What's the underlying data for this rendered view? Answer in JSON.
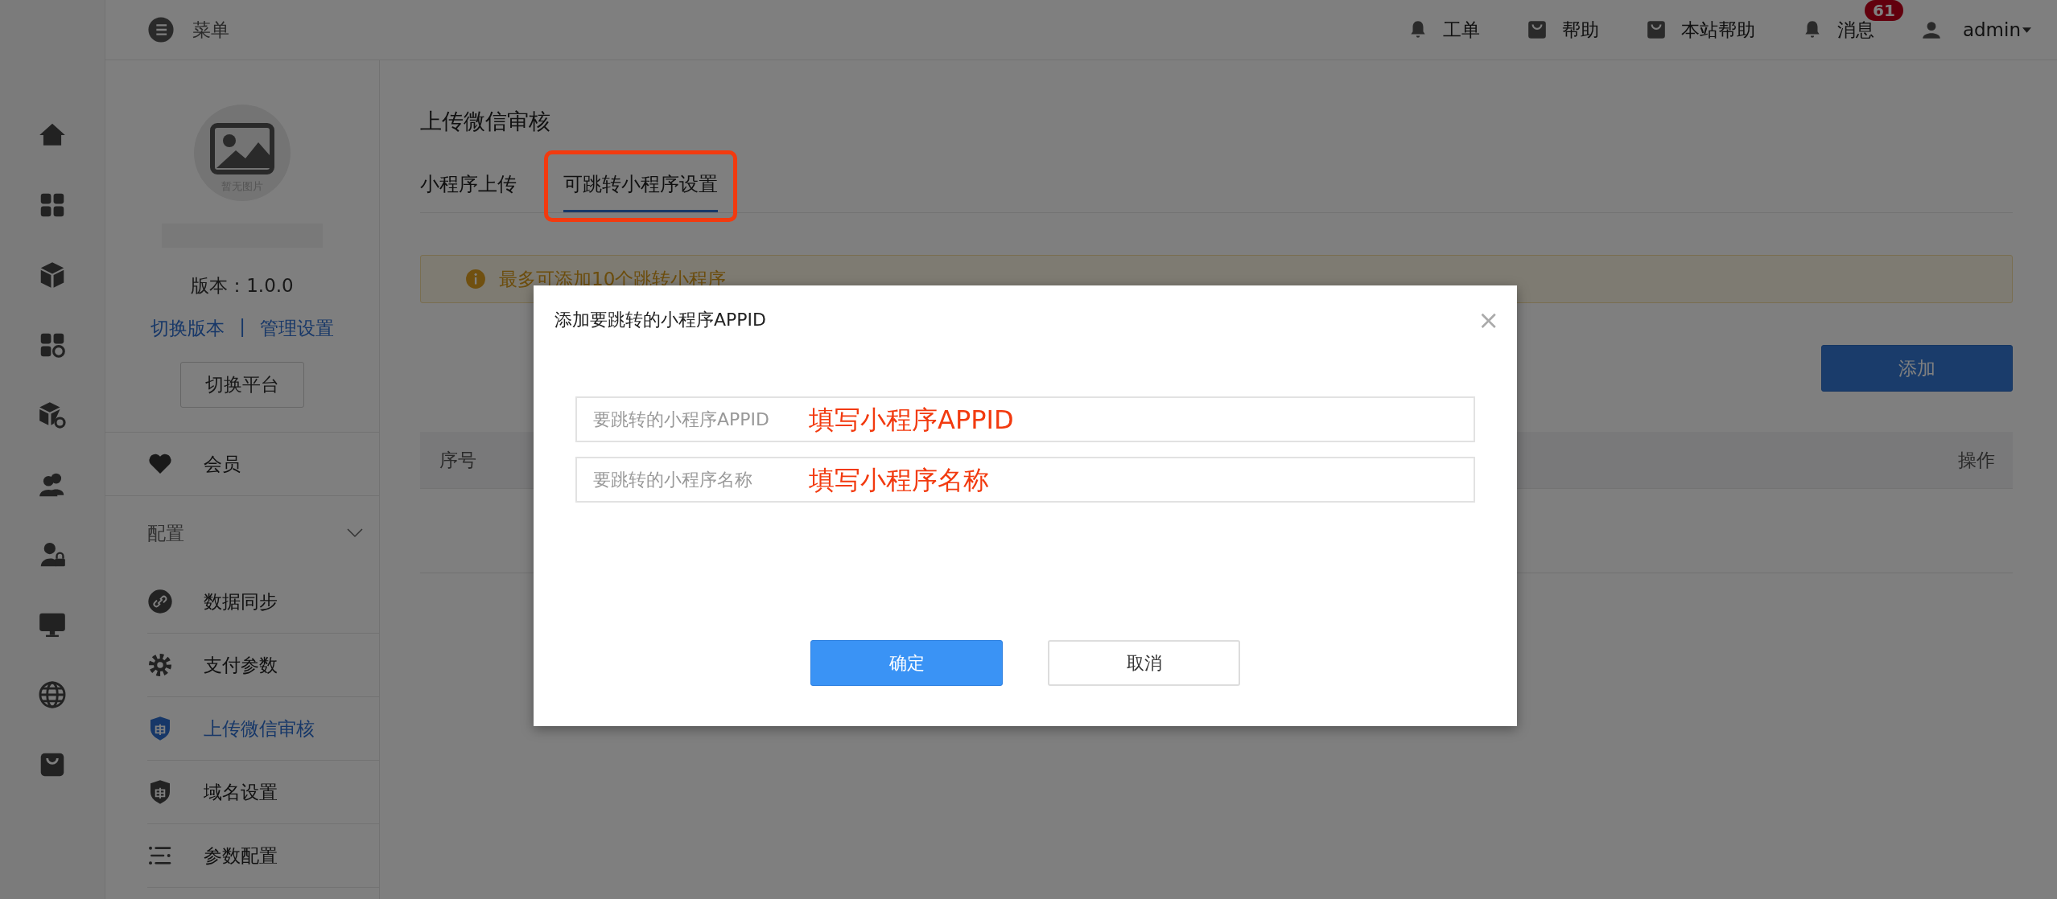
{
  "rail": [
    {
      "kind": "home"
    },
    {
      "kind": "grid"
    },
    {
      "kind": "cube"
    },
    {
      "kind": "grid-gear"
    },
    {
      "kind": "cube-gear"
    },
    {
      "kind": "users"
    },
    {
      "kind": "user-lock"
    },
    {
      "kind": "monitor"
    },
    {
      "kind": "globe"
    },
    {
      "kind": "bag"
    }
  ],
  "top_bar": {
    "menu_label": "菜单",
    "links": [
      {
        "label": "工单",
        "kind": "bell"
      },
      {
        "label": "帮助",
        "kind": "bag"
      },
      {
        "label": "本站帮助",
        "kind": "bag"
      },
      {
        "label": "消息",
        "kind": "bell",
        "badge": "61"
      }
    ],
    "user": "admin"
  },
  "profile": {
    "avatar_text": "暂无图片",
    "version": "版本：1.0.0",
    "links": [
      "切换版本",
      "管理设置"
    ],
    "separator": "|",
    "switch_button": "切换平台"
  },
  "menu": [
    {
      "kind": "item",
      "label": "会员",
      "selected": false
    },
    {
      "kind": "section",
      "label": "配置",
      "expanded": true,
      "children": [
        {
          "label": "数据同步",
          "kind": "link",
          "selected": false
        },
        {
          "label": "支付参数",
          "kind": "gear",
          "selected": false
        },
        {
          "label": "上传微信审核",
          "kind": "shield",
          "selected": true
        },
        {
          "label": "域名设置",
          "kind": "shield",
          "selected": false
        },
        {
          "label": "参数配置",
          "kind": "list",
          "selected": false
        }
      ]
    }
  ],
  "page": {
    "title": "上传微信审核",
    "tabs": [
      {
        "label": "小程序上传",
        "selected": false,
        "annotated": false
      },
      {
        "label": "可跳转小程序设置",
        "selected": true,
        "annotated": true
      }
    ],
    "alert": "最多可添加10个跳转小程序",
    "add_button": "添加",
    "table": {
      "columns": [
        "序号",
        "操作"
      ]
    }
  },
  "dialog": {
    "title": "添加要跳转的小程序APPID",
    "close": "×",
    "fields": [
      {
        "placeholder": "要跳转的小程序APPID",
        "annotation": "填写小程序APPID"
      },
      {
        "placeholder": "要跳转的小程序名称",
        "annotation": "填写小程序名称"
      }
    ],
    "buttons": [
      {
        "label": "确定",
        "kind": "primary"
      },
      {
        "label": "取消",
        "kind": "default"
      }
    ]
  }
}
